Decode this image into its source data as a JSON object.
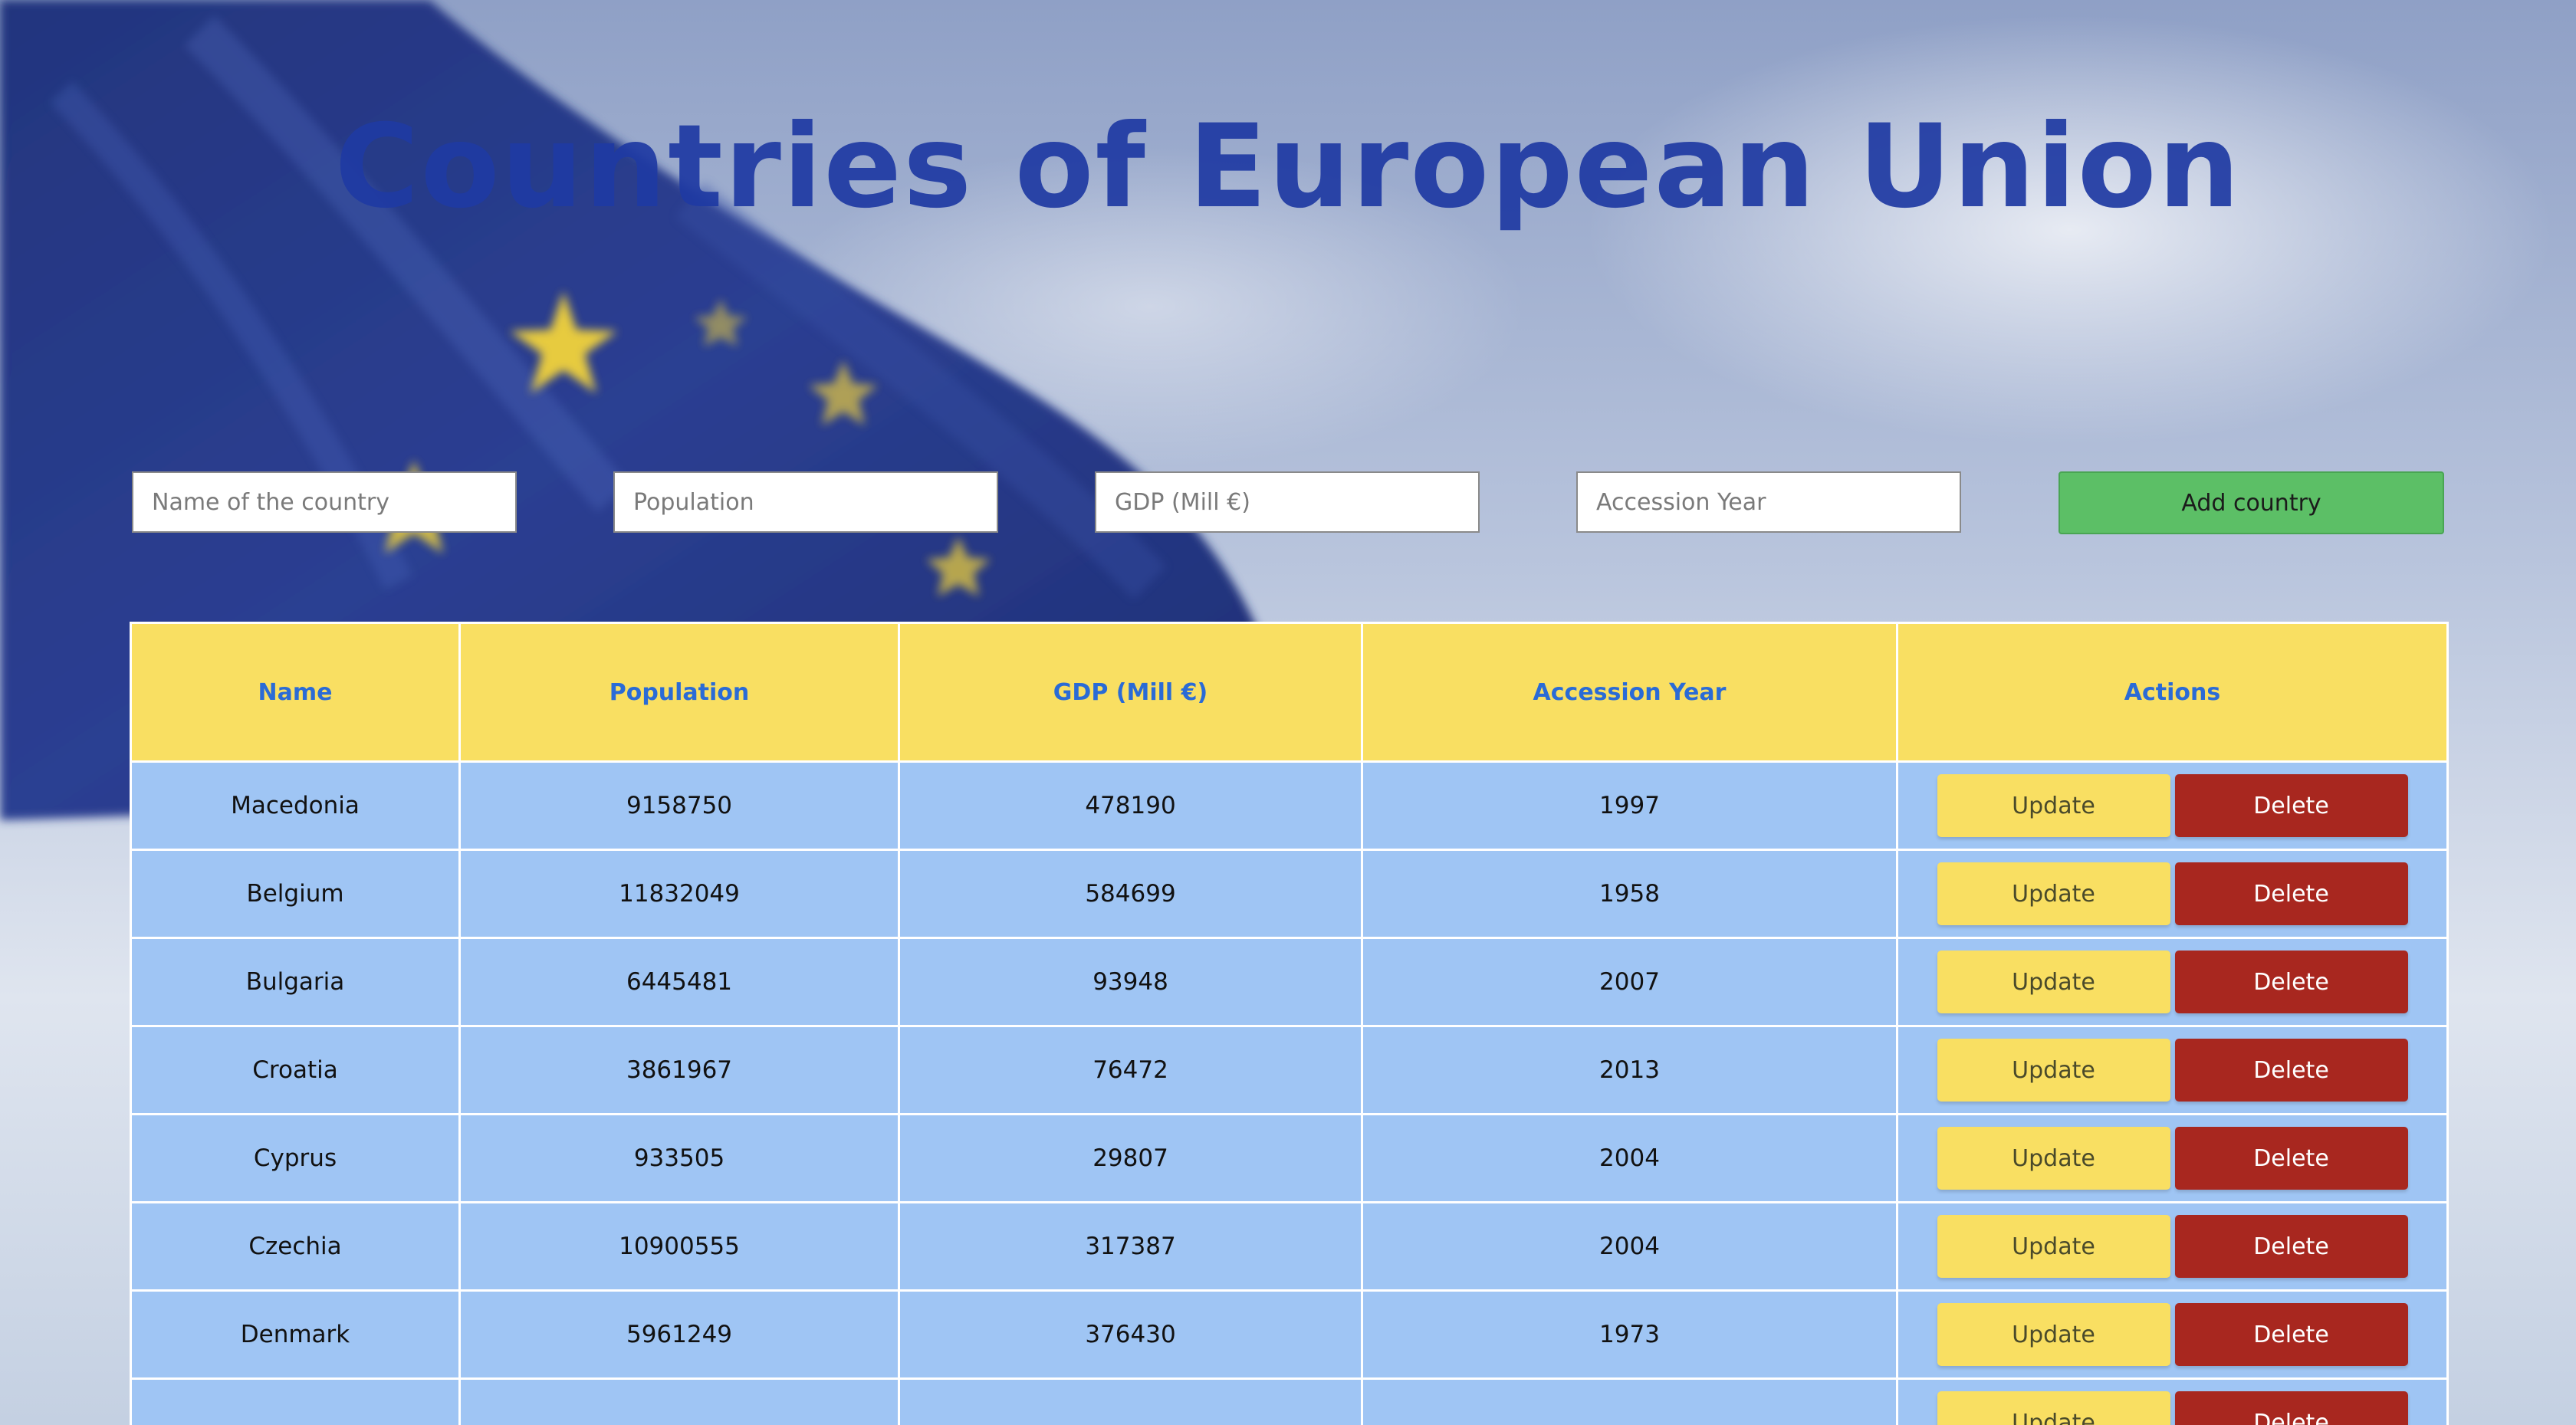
{
  "header": {
    "title": "Countries of European Union"
  },
  "form": {
    "name_placeholder": "Name of the country",
    "population_placeholder": "Population",
    "gdp_placeholder": "GDP (Mill €)",
    "year_placeholder": "Accession Year",
    "add_label": "Add country"
  },
  "table": {
    "columns": [
      "Name",
      "Population",
      "GDP (Mill €)",
      "Accession Year",
      "Actions"
    ],
    "update_label": "Update",
    "delete_label": "Delete",
    "rows": [
      {
        "name": "Macedonia",
        "population": "9158750",
        "gdp": "478190",
        "year": "1997"
      },
      {
        "name": "Belgium",
        "population": "11832049",
        "gdp": "584699",
        "year": "1958"
      },
      {
        "name": "Bulgaria",
        "population": "6445481",
        "gdp": "93948",
        "year": "2007"
      },
      {
        "name": "Croatia",
        "population": "3861967",
        "gdp": "76472",
        "year": "2013"
      },
      {
        "name": "Cyprus",
        "population": "933505",
        "gdp": "29807",
        "year": "2004"
      },
      {
        "name": "Czechia",
        "population": "10900555",
        "gdp": "317387",
        "year": "2004"
      },
      {
        "name": "Denmark",
        "population": "5961249",
        "gdp": "376430",
        "year": "1973"
      },
      {
        "name": "",
        "population": "",
        "gdp": "",
        "year": ""
      }
    ]
  },
  "colors": {
    "title": "#1f3aa3",
    "header_bg": "#f9df62",
    "header_text": "#2a6bd6",
    "row_bg": "#9fc5f4",
    "add_button": "#5cbf66",
    "update_button": "#f9df62",
    "delete_button": "#a8271f"
  },
  "background": {
    "image": "eu-flag-waving",
    "star_icon": "star-icon"
  }
}
